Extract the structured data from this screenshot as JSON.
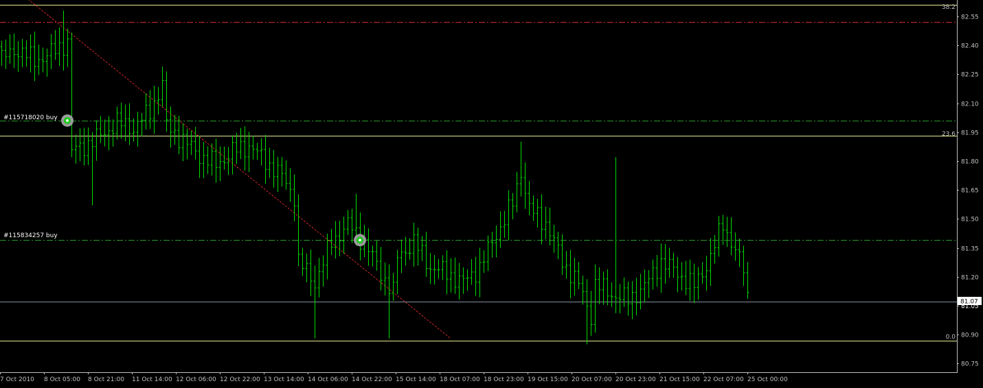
{
  "colors": {
    "background": "#000000",
    "bars": "#00dd00",
    "axis": "#c0c0c0",
    "fib_lines": "#e8e890",
    "resistance_line": "#d02828",
    "trend_line": "#d02828",
    "order_lines": "#2a9a2a",
    "bid_line": "#8090a0",
    "price_tag_bg": "#ffffff",
    "price_tag_text": "#000000"
  },
  "labels": {
    "order1": "#115718020 buy",
    "order2": "#115834257 buy",
    "fib_top": "38.2",
    "fib_mid": "23.6",
    "fib_bottom": "0.0",
    "current_price": "81.07",
    "hidden_price_digits": "81.05"
  },
  "chart_data": {
    "type": "ohlc",
    "symbol": "",
    "price_axis": {
      "ticks": [
        "82.55",
        "82.40",
        "82.25",
        "82.10",
        "81.95",
        "81.80",
        "81.65",
        "81.50",
        "81.35",
        "81.20",
        "81.05",
        "80.90",
        "80.75"
      ],
      "range": [
        80.705,
        82.635
      ]
    },
    "time_axis": {
      "labels": [
        "7 Oct 2010",
        "8 Oct 05:00",
        "8 Oct 21:00",
        "11 Oct 14:00",
        "12 Oct 06:00",
        "12 Oct 22:00",
        "13 Oct 14:00",
        "14 Oct 06:00",
        "14 Oct 22:00",
        "15 Oct 14:00",
        "18 Oct 07:00",
        "18 Oct 23:00",
        "19 Oct 15:00",
        "20 Oct 07:00",
        "20 Oct 23:00",
        "21 Oct 15:00",
        "22 Oct 07:00",
        "25 Oct 00:00"
      ]
    },
    "horizontal_levels": [
      {
        "name": "fib-38.2",
        "price": 82.61,
        "style": "solid"
      },
      {
        "name": "fib-23.6",
        "price": 81.93,
        "style": "solid"
      },
      {
        "name": "fib-0.0",
        "price": 80.87,
        "style": "solid"
      },
      {
        "name": "resistance",
        "price": 82.52,
        "style": "dash-dot"
      },
      {
        "name": "order-115718020",
        "price": 82.01,
        "style": "dash-dot"
      },
      {
        "name": "order-115834257",
        "price": 81.39,
        "style": "dash-dot"
      },
      {
        "name": "bid",
        "price": 81.07,
        "style": "solid"
      }
    ],
    "trendline": {
      "from": {
        "bar": 0,
        "price": 82.75
      },
      "to": {
        "bar": 109,
        "price": 80.88
      }
    },
    "order_markers": [
      {
        "label": "#115718020 buy",
        "bar": 16,
        "price": 82.01
      },
      {
        "label": "#115834257 buy",
        "bar": 87,
        "price": 81.39
      }
    ],
    "close_path": [
      [
        0,
        82.33
      ],
      [
        4,
        82.38
      ],
      [
        8,
        82.32
      ],
      [
        12,
        82.36
      ],
      [
        16,
        82.42
      ],
      [
        17,
        81.85
      ],
      [
        20,
        81.88
      ],
      [
        24,
        81.93
      ],
      [
        28,
        82.0
      ],
      [
        32,
        81.97
      ],
      [
        36,
        82.06
      ],
      [
        39,
        82.2
      ],
      [
        40,
        81.98
      ],
      [
        44,
        81.91
      ],
      [
        48,
        81.83
      ],
      [
        52,
        81.78
      ],
      [
        56,
        81.85
      ],
      [
        60,
        81.88
      ],
      [
        64,
        81.8
      ],
      [
        68,
        81.72
      ],
      [
        71,
        81.62
      ],
      [
        72,
        81.28
      ],
      [
        76,
        81.17
      ],
      [
        80,
        81.38
      ],
      [
        84,
        81.47
      ],
      [
        88,
        81.38
      ],
      [
        92,
        81.22
      ],
      [
        95,
        81.12
      ],
      [
        96,
        81.3
      ],
      [
        100,
        81.38
      ],
      [
        104,
        81.25
      ],
      [
        108,
        81.22
      ],
      [
        112,
        81.17
      ],
      [
        116,
        81.25
      ],
      [
        120,
        81.42
      ],
      [
        124,
        81.58
      ],
      [
        126,
        81.75
      ],
      [
        128,
        81.55
      ],
      [
        132,
        81.48
      ],
      [
        136,
        81.28
      ],
      [
        140,
        81.16
      ],
      [
        143,
        81.0
      ],
      [
        144,
        81.16
      ],
      [
        148,
        81.11
      ],
      [
        152,
        81.08
      ],
      [
        156,
        81.15
      ],
      [
        160,
        81.28
      ],
      [
        164,
        81.22
      ],
      [
        168,
        81.15
      ],
      [
        172,
        81.3
      ],
      [
        175,
        81.48
      ],
      [
        177,
        81.38
      ],
      [
        180,
        81.24
      ],
      [
        181,
        81.1
      ]
    ],
    "spikes": [
      {
        "bar": 15,
        "high": 82.58
      },
      {
        "bar": 22,
        "low": 81.57
      },
      {
        "bar": 39,
        "high": 82.29
      },
      {
        "bar": 76,
        "low": 80.88
      },
      {
        "bar": 86,
        "high": 81.63
      },
      {
        "bar": 94,
        "low": 80.88
      },
      {
        "bar": 126,
        "high": 81.9
      },
      {
        "bar": 142,
        "low": 80.85
      },
      {
        "bar": 149,
        "high": 81.82
      }
    ],
    "bar_count": 182
  }
}
